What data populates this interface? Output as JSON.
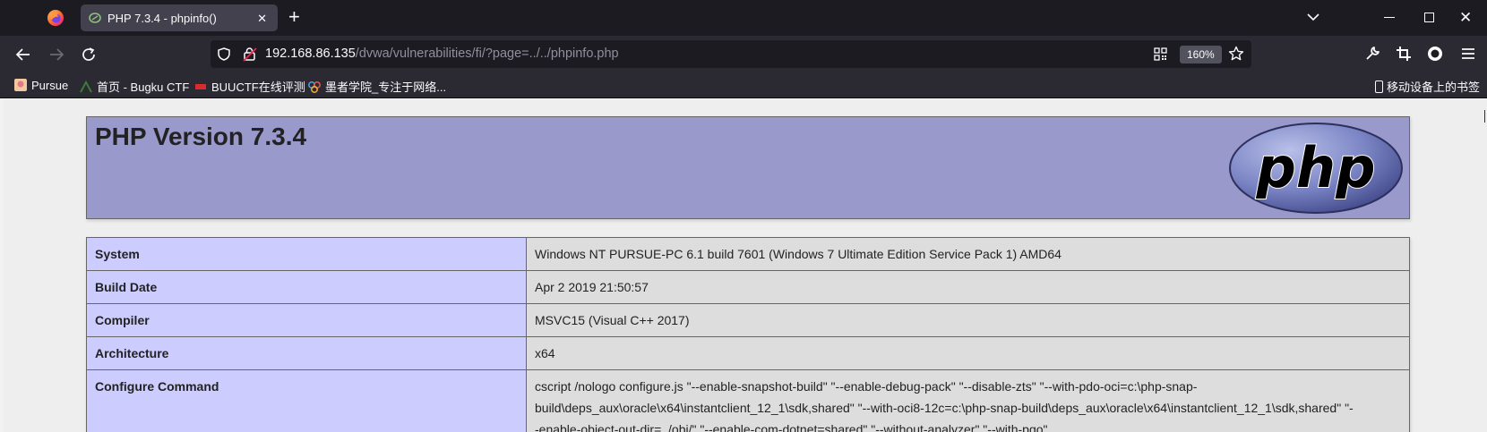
{
  "browser": {
    "tab_title": "PHP 7.3.4 - phpinfo()",
    "tab_close": "✕",
    "new_tab": "+",
    "url_host": "192.168.86.135",
    "url_path": "/dvwa/vulnerabilities/fi/?page=../../phpinfo.php",
    "zoom": "160%",
    "window_close": "✕"
  },
  "bookmarks": [
    {
      "label": "Pursue",
      "icon": "pursue-favicon"
    },
    {
      "label": "首页 - Bugku CTF",
      "icon": "bugku-favicon"
    },
    {
      "label": "BUUCTF在线评测",
      "icon": "buuctf-favicon"
    },
    {
      "label": "墨者学院_专注于网络...",
      "icon": "mozhe-favicon"
    }
  ],
  "mobile_bookmarks": "移动设备上的书签",
  "page": {
    "heading": "PHP Version 7.3.4",
    "logo_text": "php",
    "rows": [
      {
        "key": "System",
        "value": "Windows NT PURSUE-PC 6.1 build 7601 (Windows 7 Ultimate Edition Service Pack 1) AMD64"
      },
      {
        "key": "Build Date",
        "value": "Apr 2 2019 21:50:57"
      },
      {
        "key": "Compiler",
        "value": "MSVC15 (Visual C++ 2017)"
      },
      {
        "key": "Architecture",
        "value": "x64"
      },
      {
        "key": "Configure Command",
        "value": "cscript /nologo configure.js \"--enable-snapshot-build\" \"--enable-debug-pack\" \"--disable-zts\" \"--with-pdo-oci=c:\\php-snap-build\\deps_aux\\oracle\\x64\\instantclient_12_1\\sdk,shared\" \"--with-oci8-12c=c:\\php-snap-build\\deps_aux\\oracle\\x64\\instantclient_12_1\\sdk,shared\" \"--enable-object-out-dir=../obj/\" \"--enable-com-dotnet=shared\" \"--without-analyzer\" \"--with-pgo\""
      }
    ]
  },
  "colors": {
    "header_bg": "#9999cc",
    "key_bg": "#ccccff",
    "value_bg": "#dddddd",
    "chrome_dark": "#1c1b22",
    "chrome_toolbar": "#2b2a33"
  }
}
